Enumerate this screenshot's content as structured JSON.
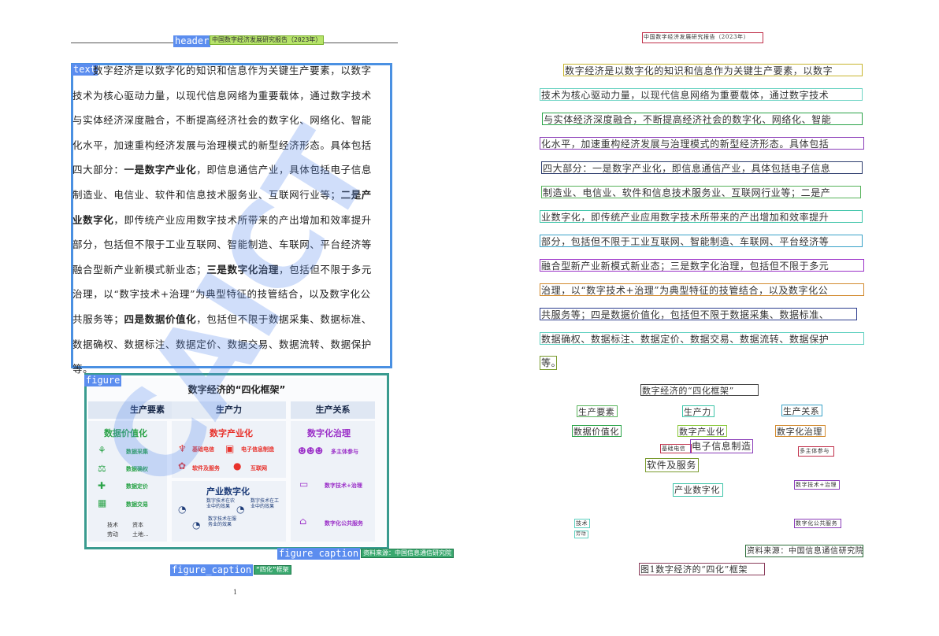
{
  "left_page": {
    "labels": {
      "header": "header",
      "text": "text",
      "figure": "figure",
      "figure_caption_1": "figure caption",
      "figure_caption_2": "figure_caption"
    },
    "header_text": "中国数字经济发展研究报告（2023年）",
    "body_lines": [
      {
        "parts": [
          {
            "t": "数字经济是以数字化的知识和信息作为关键生产要素，以数字"
          }
        ]
      },
      {
        "parts": [
          {
            "t": "技术为核心驱动力量，以现代信息网络为重要载体，通过数字技术"
          }
        ]
      },
      {
        "parts": [
          {
            "t": "与实体经济深度融合，不断提高经济社会的数字化、网络化、智能"
          }
        ]
      },
      {
        "parts": [
          {
            "t": "化水平，加速重构经济发展与治理模式的新型经济形态。具体包括"
          }
        ]
      },
      {
        "parts": [
          {
            "t": "四大部分："
          },
          {
            "t": "一是数字产业化",
            "b": true
          },
          {
            "t": "，即信息通信产业，具体包括电子信息"
          }
        ]
      },
      {
        "parts": [
          {
            "t": "制造业、电信业、软件和信息技术服务业、互联网行业等；"
          },
          {
            "t": "二是产",
            "b": true
          }
        ]
      },
      {
        "parts": [
          {
            "t": "业数字化",
            "b": true
          },
          {
            "t": "，即传统产业应用数字技术所带来的产出增加和效率提升"
          }
        ]
      },
      {
        "parts": [
          {
            "t": "部分，包括但不限于工业互联网、智能制造、车联网、平台经济等"
          }
        ]
      },
      {
        "parts": [
          {
            "t": "融合型新产业新模式新业态；"
          },
          {
            "t": "三是数字化治理",
            "b": true
          },
          {
            "t": "，包括但不限于多元"
          }
        ]
      },
      {
        "parts": [
          {
            "t": "治理，以“数字技术+治理”为典型特征的技管结合，以及数字化公"
          }
        ]
      },
      {
        "parts": [
          {
            "t": "共服务等；"
          },
          {
            "t": "四是数据价值化",
            "b": true
          },
          {
            "t": "，包括但不限于数据采集、数据标准、"
          }
        ]
      },
      {
        "parts": [
          {
            "t": "数据确权、数据标注、数据定价、数据交易、数据流转、数据保护"
          }
        ]
      },
      {
        "parts": [
          {
            "t": "等。"
          }
        ]
      }
    ],
    "figure": {
      "title": "数字经济的“四化框架”",
      "col1": "生产要素",
      "col2": "生产力",
      "col3": "生产关系",
      "sec1": "数据价值化",
      "sec2": "数字产业化",
      "sec3": "数字化治理",
      "sec4": "产业数字化",
      "data_items": [
        "数据采集",
        "数据确权",
        "数据定价",
        "数据交易"
      ],
      "factors": [
        "技术",
        "资本",
        "劳动",
        "土地..."
      ],
      "ind_items": [
        "基础电信",
        "电子信息制造",
        "软件及服务",
        "互联网"
      ],
      "digit_items": [
        "数字技术在农业中的效果",
        "数字技术在工业中的效果",
        "数字技术在服务业的效果"
      ],
      "gov_items": [
        "多主体参与",
        "数字技术+治理",
        "数字化公共服务"
      ]
    },
    "source_tag": "资料来源：中国信息通信研究院",
    "caption_tag": "“四化”框架",
    "page_number": "1"
  },
  "right_page": {
    "header": "中国数字经济发展研究报告（2023年）",
    "lines": [
      "数字经济是以数字化的知识和信息作为关键生产要素，以数字",
      "技术为核心驱动力量，以现代信息网络为重要载体，通过数字技术",
      "与实体经济深度融合，不断提高经济社会的数字化、网络化、智能",
      "化水平，加速重构经济发展与治理模式的新型经济形态。具体包括",
      "四大部分：一是数字产业化，即信息通信产业，具体包括电子信息",
      "制造业、电信业、软件和信息技术服务业、互联网行业等；二是产",
      "业数字化，即传统产业应用数字技术所带来的产出增加和效率提升",
      "部分，包括但不限于工业互联网、智能制造、车联网、平台经济等",
      "融合型新产业新模式新业态；三是数字化治理，包括但不限于多元",
      "治理，以“数字技术+治理”为典型特征的技管结合，以及数字化公",
      "共服务等；四是数据价值化，包括但不限于数据采集、数据标准、",
      "数据确权、数据标注、数据定价、数据交易、数据流转、数据保护",
      "等。"
    ],
    "fig_title": "数字经济的“四化框架”",
    "col1": "生产要素",
    "col2": "生产力",
    "col3": "生产关系",
    "sec1": "数据价值化",
    "sec2": "数字产业化",
    "sec3": "数字化治理",
    "item_basic": "基础电信",
    "item_elec": "电子信息制造",
    "item_multi": "多主体参与",
    "item_soft": "软件及服务",
    "sec4": "产业数字化",
    "item_tech_gov": "数字技术+治理",
    "item_tech": "技术",
    "item_labor": "劳动",
    "item_public": "数字化公共服务",
    "source": "资料来源：中国信息通信研究院",
    "caption": "图1数字经济的“四化”框架"
  },
  "colors": {
    "text_box": "#4a90e2",
    "figure_box": "#3a9b8f",
    "label_bg": "#5b8def",
    "watermark": "#5b8def"
  }
}
